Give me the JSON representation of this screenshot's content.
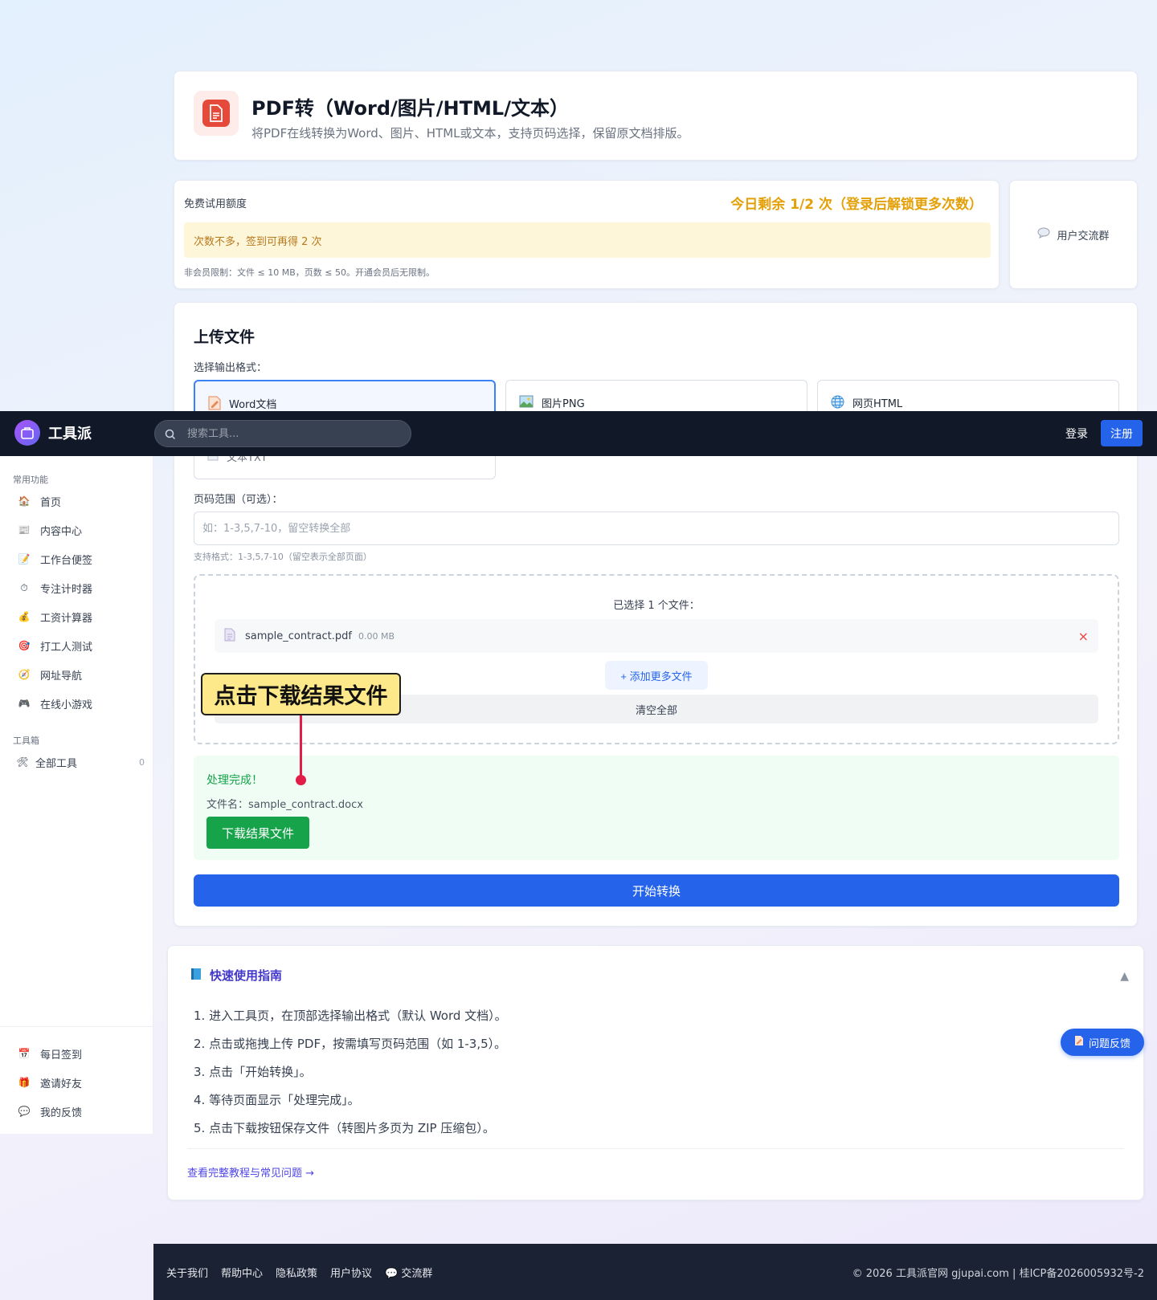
{
  "header": {
    "title": "PDF转（Word/图片/HTML/文本）",
    "subtitle": "将PDF在线转换为Word、图片、HTML或文本，支持页码选择，保留原文档排版。",
    "icon": "pdf-document-icon"
  },
  "quota": {
    "label": "免费试用额度",
    "remaining": "今日剩余 1/2 次（登录后解锁更多次数）",
    "tip": "次数不多，签到可再得 2 次",
    "limit": "非会员限制：文件 ≤ 10 MB，页数 ≤ 50。开通会员后无限制。"
  },
  "group": {
    "label": "用户交流群",
    "icon": "chat-bubble-icon"
  },
  "upload": {
    "title": "上传文件",
    "format_label": "选择输出格式：",
    "formats": [
      {
        "label": "Word文档",
        "icon": "word-doc-icon",
        "selected": true
      },
      {
        "label": "图片PNG",
        "icon": "image-icon",
        "selected": false
      },
      {
        "label": "网页HTML",
        "icon": "globe-icon",
        "selected": false
      },
      {
        "label": "文本TXT",
        "icon": "text-file-icon",
        "selected": false
      }
    ],
    "page_range_label": "页码范围（可选）：",
    "page_range_placeholder": "如：1-3,5,7-10，留空转换全部",
    "page_range_hint": "支持格式：1-3,5,7-10（留空表示全部页面）",
    "selected_count": "已选择 1 个文件：",
    "file_name": "sample_contract.pdf",
    "file_size": "0.00 MB",
    "remove": "×",
    "add_more": "+ 添加更多文件",
    "clear_all": "清空全部",
    "result_title": "处理完成！",
    "result_file": "文件名：sample_contract.docx",
    "download": "下载结果文件",
    "start": "开始转换"
  },
  "callout": {
    "text": "点击下载结果文件",
    "color": "#e11d48"
  },
  "guide": {
    "title": "快速使用指南",
    "steps": [
      "1. 进入工具页，在顶部选择输出格式（默认 Word 文档）。",
      "2. 点击或拖拽上传 PDF，按需填写页码范围（如 1-3,5）。",
      "3. 点击「开始转换」。",
      "4. 等待页面显示「处理完成」。",
      "5. 点击下载按钮保存文件（转图片多页为 ZIP 压缩包）。"
    ],
    "more_link": "查看完整教程与常见问题 →",
    "toggle": "▲"
  },
  "feedback": {
    "label": "问题反馈"
  },
  "topbar": {
    "brand": "工具派",
    "search_placeholder": "搜索工具...",
    "login": "登录",
    "register": "注册"
  },
  "sidebar": {
    "section1": "常用功能",
    "items": [
      {
        "label": "首页",
        "icon": "home-icon"
      },
      {
        "label": "内容中心",
        "icon": "news-icon"
      },
      {
        "label": "工作台便签",
        "icon": "memo-icon"
      },
      {
        "label": "专注计时器",
        "icon": "timer-icon"
      },
      {
        "label": "工资计算器",
        "icon": "money-bag-icon"
      },
      {
        "label": "打工人测试",
        "icon": "target-icon"
      },
      {
        "label": "网址导航",
        "icon": "compass-icon"
      },
      {
        "label": "在线小游戏",
        "icon": "gamepad-icon"
      }
    ],
    "section2": "工具箱",
    "all_tools": "全部工具",
    "all_tools_count": "0",
    "bottom": [
      {
        "label": "每日签到",
        "icon": "calendar-icon"
      },
      {
        "label": "邀请好友",
        "icon": "gift-icon"
      },
      {
        "label": "我的反馈",
        "icon": "speech-icon"
      }
    ]
  },
  "footer": {
    "links": [
      "关于我们",
      "帮助中心",
      "隐私政策",
      "用户协议",
      "交流群"
    ],
    "copyright": "© 2026 工具派官网 gjupai.com | 桂ICP备2026005932号-2"
  },
  "colors": {
    "primary": "#2563eb",
    "success": "#16a34a",
    "warning": "#e3a008",
    "dark": "#111827"
  }
}
